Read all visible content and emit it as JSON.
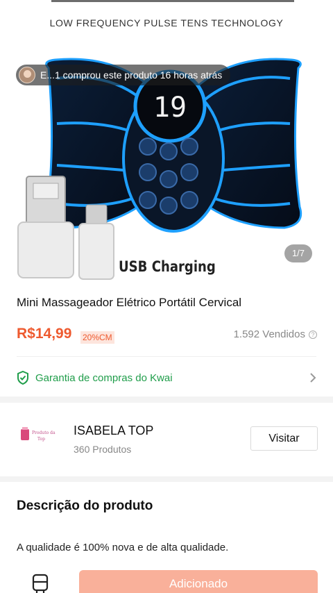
{
  "hero": {
    "tagline": "LOW FREQUENCY PULSE TENS TECHNOLOGY",
    "usb_label": "USB Charging",
    "image_counter": "1/7",
    "toast_text": "E...1 comprou este produto 16 horas atrás"
  },
  "product": {
    "title": "Mini Massageador Elétrico Portátil Cervical",
    "price": "R$14,99",
    "coupon": "20%CM",
    "sold": "1.592 Vendidos",
    "guarantee": "Garantia de compras do Kwai"
  },
  "store": {
    "name": "ISABELA TOP",
    "products": "360 Produtos",
    "visit_label": "Visitar",
    "logo_text": "Produto da Top"
  },
  "description": {
    "title": "Descrição do produto",
    "text": "A qualidade é 100% nova e de alta qualidade."
  },
  "bottom": {
    "add_label": "Adicionado"
  },
  "colors": {
    "price": "#ee5a2f",
    "guarantee": "#1f9d4a",
    "add_button": "#f9b09a",
    "device_glow": "#1ea0ff"
  },
  "icons": [
    "shield-check-icon",
    "chevron-right-icon",
    "help-icon",
    "shop-icon"
  ]
}
